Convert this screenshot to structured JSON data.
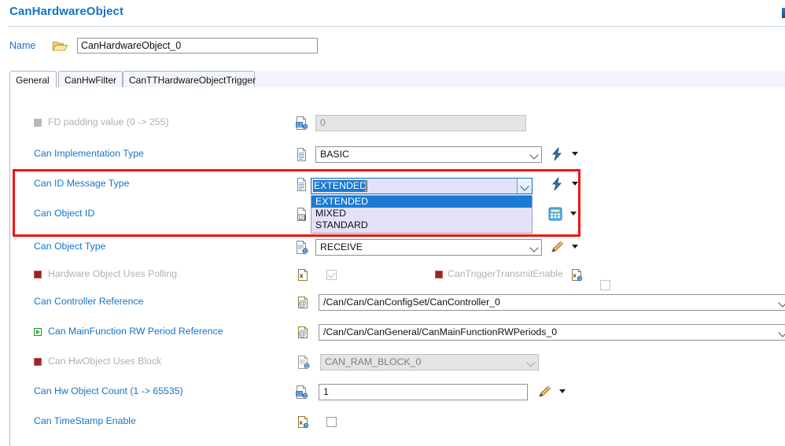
{
  "header": {
    "title": "CanHardwareObject"
  },
  "name_row": {
    "label": "Name",
    "value": "CanHardwareObject_0",
    "folder_icon": "folder-open-icon"
  },
  "tabs": [
    {
      "label": "General",
      "active": true
    },
    {
      "label": "CanHwFilter",
      "active": false
    },
    {
      "label": "CanTTHardwareObjectTrigger",
      "active": false
    }
  ],
  "rows": [
    {
      "label": "FD padding value (0 -> 255)",
      "marker": "gray-square",
      "field_icon": "numeric-document-icon",
      "control": "textbox-disabled",
      "value": "0"
    },
    {
      "label": "Can Implementation Type",
      "field_icon": "document-icon",
      "control": "combobox",
      "value": "BASIC",
      "action_icon": "blue-arrow-icon"
    },
    {
      "label": "Can ID Message Type",
      "field_icon": "document-icon",
      "control": "combobox-open",
      "value": "EXTENDED",
      "action_icon": "blue-arrow-icon"
    },
    {
      "label": "Can Object ID",
      "field_icon": "numeric-document-icon",
      "control": "hidden-behind-dropdown",
      "action_icon": "calculator-icon"
    },
    {
      "label": "Can Object Type",
      "field_icon": "document-d-icon",
      "control": "combobox",
      "value": "RECEIVE",
      "action_icon": "pencil-icon"
    },
    {
      "label": "Hardware Object Uses Polling.",
      "marker": "red-square",
      "field_icon": "x-document-icon",
      "control": "checkbox-checked-disabled"
    },
    {
      "label": "Can Controller Reference",
      "field_icon": "at-document-icon",
      "control": "combobox-wide",
      "value": "/Can/Can/CanConfigSet/CanController_0"
    },
    {
      "label": "Can MainFunction RW Period Reference",
      "marker": "green-play",
      "field_icon": "at-document-icon",
      "control": "combobox-wide",
      "value": "/Can/Can/CanGeneral/CanMainFunctionRWPeriods_0"
    },
    {
      "label": "Can HwObject Uses Block",
      "marker": "red-square",
      "field_icon": "document-d-icon",
      "control": "combobox-disabled",
      "value": "CAN_RAM_BLOCK_0"
    },
    {
      "label": "Can Hw Object Count (1 -> 65535)",
      "field_icon": "numeric-document-icon",
      "control": "textbox",
      "value": "1",
      "action_icon": "pencil-icon"
    },
    {
      "label": "Can TimeStamp Enable",
      "field_icon": "x-document-icon",
      "control": "checkbox"
    }
  ],
  "inline_extra": {
    "can_trigger_transmit_enable_label": "CanTriggerTransmitEnable",
    "can_trigger_transmit_enable_icon": "x-document-icon",
    "can_trigger_transmit_enable_marker": "red-square"
  },
  "dropdown": {
    "selected": "EXTENDED",
    "options": [
      "EXTENDED",
      "MIXED",
      "STANDARD"
    ]
  },
  "colors": {
    "accent_link": "#1573c8",
    "header_title": "#1573c8",
    "highlight_box": "#fb0f0f",
    "dropdown_bg": "#e3e1f7",
    "dropdown_selected": "#1a7ad4",
    "disabled_text": "#b0b0b0"
  }
}
